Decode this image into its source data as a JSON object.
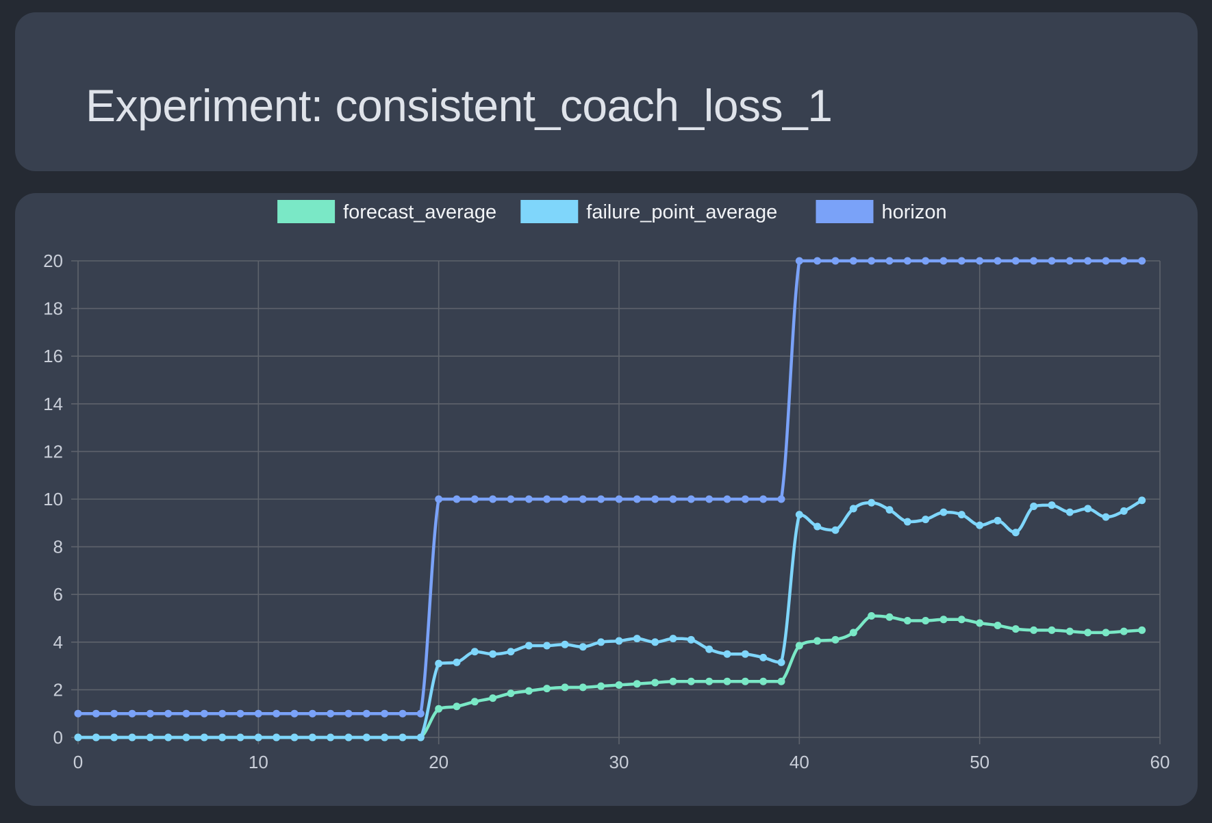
{
  "header": {
    "title": "Experiment: consistent_coach_loss_1"
  },
  "chart_data": {
    "type": "line",
    "title": "",
    "xlabel": "",
    "ylabel": "",
    "xlim": [
      0,
      60
    ],
    "ylim": [
      0,
      20
    ],
    "x_ticks": [
      "0",
      "10",
      "20",
      "30",
      "40",
      "50",
      "60"
    ],
    "y_ticks": [
      "0",
      "2",
      "4",
      "6",
      "8",
      "10",
      "12",
      "14",
      "16",
      "18",
      "20"
    ],
    "grid": true,
    "legend_position": "top-center",
    "x": [
      0,
      1,
      2,
      3,
      4,
      5,
      6,
      7,
      8,
      9,
      10,
      11,
      12,
      13,
      14,
      15,
      16,
      17,
      18,
      19,
      20,
      21,
      22,
      23,
      24,
      25,
      26,
      27,
      28,
      29,
      30,
      31,
      32,
      33,
      34,
      35,
      36,
      37,
      38,
      39,
      40,
      41,
      42,
      43,
      44,
      45,
      46,
      47,
      48,
      49,
      50,
      51,
      52,
      53,
      54,
      55,
      56,
      57,
      58,
      59
    ],
    "series": [
      {
        "name": "forecast_average",
        "color": "#7ae8c6",
        "values": [
          0,
          0,
          0,
          0,
          0,
          0,
          0,
          0,
          0,
          0,
          0,
          0,
          0,
          0,
          0,
          0,
          0,
          0,
          0,
          0,
          1.2,
          1.3,
          1.5,
          1.65,
          1.85,
          1.95,
          2.05,
          2.1,
          2.1,
          2.15,
          2.2,
          2.25,
          2.3,
          2.35,
          2.35,
          2.35,
          2.35,
          2.35,
          2.35,
          2.35,
          3.85,
          4.05,
          4.1,
          4.4,
          5.1,
          5.05,
          4.9,
          4.9,
          4.95,
          4.95,
          4.8,
          4.7,
          4.55,
          4.5,
          4.5,
          4.45,
          4.4,
          4.4,
          4.45,
          4.5
        ]
      },
      {
        "name": "failure_point_average",
        "color": "#7fd6fb",
        "values": [
          0,
          0,
          0,
          0,
          0,
          0,
          0,
          0,
          0,
          0,
          0,
          0,
          0,
          0,
          0,
          0,
          0,
          0,
          0,
          0,
          3.1,
          3.15,
          3.6,
          3.5,
          3.6,
          3.85,
          3.85,
          3.9,
          3.8,
          4.0,
          4.05,
          4.15,
          4.0,
          4.15,
          4.1,
          3.7,
          3.5,
          3.5,
          3.35,
          3.15,
          9.35,
          8.85,
          8.7,
          9.6,
          9.85,
          9.55,
          9.05,
          9.15,
          9.45,
          9.35,
          8.9,
          9.1,
          8.6,
          9.7,
          9.75,
          9.45,
          9.6,
          9.25,
          9.5,
          9.95
        ]
      },
      {
        "name": "horizon",
        "color": "#7aa2f8",
        "values": [
          1,
          1,
          1,
          1,
          1,
          1,
          1,
          1,
          1,
          1,
          1,
          1,
          1,
          1,
          1,
          1,
          1,
          1,
          1,
          1,
          10,
          10,
          10,
          10,
          10,
          10,
          10,
          10,
          10,
          10,
          10,
          10,
          10,
          10,
          10,
          10,
          10,
          10,
          10,
          10,
          20,
          20,
          20,
          20,
          20,
          20,
          20,
          20,
          20,
          20,
          20,
          20,
          20,
          20,
          20,
          20,
          20,
          20,
          20,
          20
        ]
      }
    ]
  }
}
